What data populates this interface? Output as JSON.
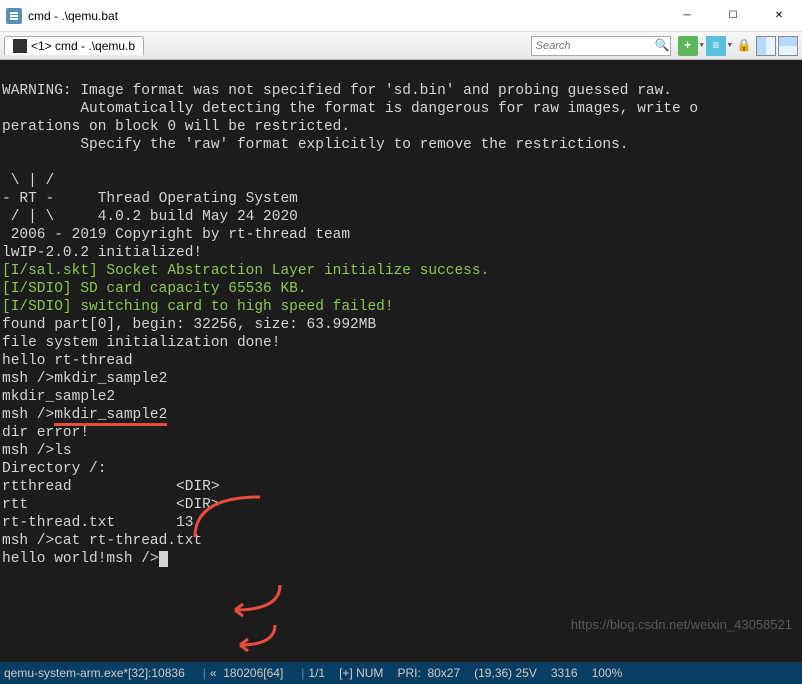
{
  "window": {
    "title": "cmd - .\\qemu.bat"
  },
  "tab": {
    "label": "<1> cmd - .\\qemu.b"
  },
  "search": {
    "placeholder": "Search"
  },
  "terminal": {
    "line1": "WARNING: Image format was not specified for 'sd.bin' and probing guessed raw.",
    "line2": "         Automatically detecting the format is dangerous for raw images, write o",
    "line3": "perations on block 0 will be restricted.",
    "line4": "         Specify the 'raw' format explicitly to remove the restrictions.",
    "line5": "",
    "line6": " \\ | /",
    "line7": "- RT -     Thread Operating System",
    "line8": " / | \\     4.0.2 build May 24 2020",
    "line9": " 2006 - 2019 Copyright by rt-thread team",
    "line10": "lwIP-2.0.2 initialized!",
    "line11": "[I/sal.skt] Socket Abstraction Layer initialize success.",
    "line12": "[I/SDIO] SD card capacity 65536 KB.",
    "line13": "[I/SDIO] switching card to high speed failed!",
    "line14": "found part[0], begin: 32256, size: 63.992MB",
    "line15": "file system initialization done!",
    "line16": "hello rt-thread",
    "line17": "msh />mkdir_sample2",
    "line18": "mkdir_sample2",
    "line19a": "msh />",
    "line19b": "mkdir_sample2",
    "line20": "dir error!",
    "line21": "msh />ls",
    "line22": "Directory /:",
    "line23": "rtthread            <DIR>",
    "line24": "rtt                 <DIR>",
    "line25": "rt-thread.txt       13",
    "line26": "msh />cat rt-thread.txt",
    "line27": "hello world!msh />"
  },
  "statusbar": {
    "process": "qemu-system-arm.exe*[32]:10836",
    "enc": "«  180206[64]",
    "pos": "1/1",
    "ins": "[+] NUM",
    "pri": "PRI:  80x27",
    "coord": "(19,36) 25V",
    "mem": "3316",
    "zoom": "100%"
  },
  "watermark": "https://blog.csdn.net/weixin_43058521"
}
